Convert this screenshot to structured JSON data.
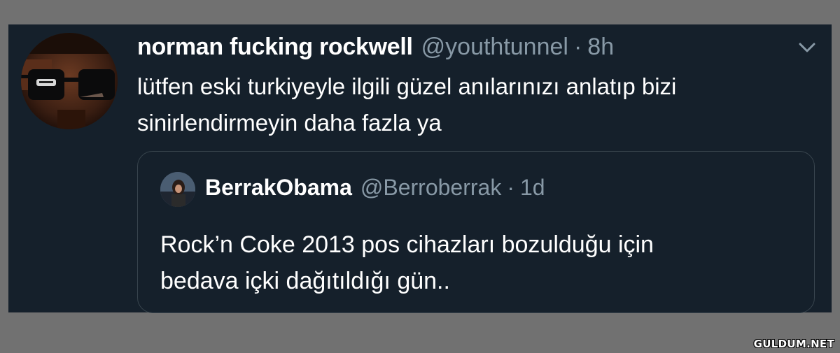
{
  "tweet": {
    "display_name": "norman fucking rockwell",
    "handle": "@youthtunnel",
    "separator": "·",
    "time": "8h",
    "text_line1": "lütfen eski turkiyeyle ilgili güzel anılarınızı anlatıp bizi",
    "text_line2": "sinirlendirmeyin daha fazla ya",
    "menu_icon": "chevron-down-icon",
    "avatar_icon": "user-avatar"
  },
  "quoted_tweet": {
    "display_name": "BerrakObama",
    "handle": "@Berroberrak",
    "separator": "·",
    "time": "1d",
    "text_line1": "Rock’n Coke 2013 pos cihazları bozulduğu için",
    "text_line2": "bedava içki dağıtıldığı gün.."
  },
  "watermark": "GULDUM.NET",
  "colors": {
    "page_bg": "#717171",
    "card_bg": "#15202b",
    "text_primary": "#ffffff",
    "text_secondary": "#8899a6",
    "border": "#38444d"
  }
}
